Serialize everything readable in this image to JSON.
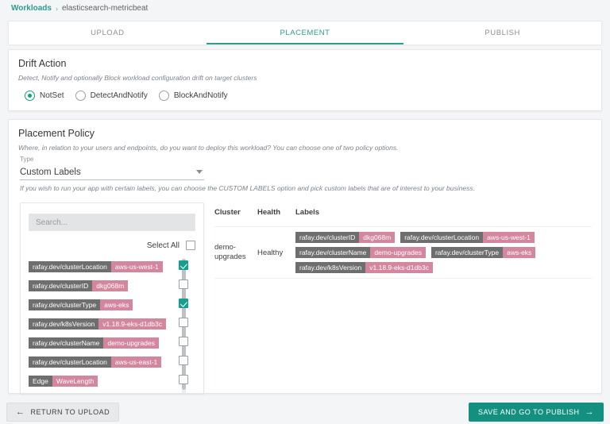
{
  "breadcrumb": {
    "root": "Workloads",
    "separator": "›",
    "current": "elasticsearch-metricbeat"
  },
  "tabs": [
    {
      "label": "UPLOAD",
      "active": false
    },
    {
      "label": "PLACEMENT",
      "active": true
    },
    {
      "label": "PUBLISH",
      "active": false
    }
  ],
  "drift": {
    "title": "Drift Action",
    "subtitle": "Detect, Notify and optionally Block workload configuration drift on target clusters",
    "options": [
      {
        "label": "NotSet",
        "selected": true
      },
      {
        "label": "DetectAndNotify",
        "selected": false
      },
      {
        "label": "BlockAndNotify",
        "selected": false
      }
    ]
  },
  "policy": {
    "title": "Placement Policy",
    "subtitle": "Where, in relation to your users and endpoints, do you want to deploy this workload? You can choose one of two policy options.",
    "type_caption": "Type",
    "type_value": "Custom Labels",
    "hint": "If you wish to run your app with certain labels, you can choose the CUSTOM LABELS option and pick custom labels that are of interest to your business."
  },
  "picker": {
    "search_placeholder": "Search...",
    "search_value": "",
    "select_all_label": "Select All",
    "select_all_checked": false,
    "labels": [
      {
        "key": "rafay.dev/clusterLocation",
        "value": "aws-us-west-1",
        "checked": true
      },
      {
        "key": "rafay.dev/clusterID",
        "value": "dkg068m",
        "checked": false
      },
      {
        "key": "rafay.dev/clusterType",
        "value": "aws-eks",
        "checked": true
      },
      {
        "key": "rafay.dev/k8sVersion",
        "value": "v1.18.9-eks-d1db3c",
        "checked": false
      },
      {
        "key": "rafay.dev/clusterName",
        "value": "demo-upgrades",
        "checked": false
      },
      {
        "key": "rafay.dev/clusterLocation",
        "value": "aws-us-east-1",
        "checked": false
      },
      {
        "key": "Edge",
        "value": "WaveLength",
        "checked": false
      }
    ]
  },
  "table": {
    "columns": [
      "Cluster",
      "Health",
      "Labels"
    ],
    "rows": [
      {
        "cluster": "demo-upgrades",
        "health": "Healthy",
        "labels": [
          {
            "key": "rafay.dev/clusterID",
            "value": "dkg068m"
          },
          {
            "key": "rafay.dev/clusterLocation",
            "value": "aws-us-west-1"
          },
          {
            "key": "rafay.dev/clusterName",
            "value": "demo-upgrades"
          },
          {
            "key": "rafay.dev/clusterType",
            "value": "aws-eks"
          },
          {
            "key": "rafay.dev/k8sVersion",
            "value": "v1.18.9-eks-d1db3c"
          }
        ]
      }
    ]
  },
  "footer": {
    "back_label": "RETURN TO UPLOAD",
    "back_icon": "arrow-left-icon",
    "next_label": "SAVE AND GO TO PUBLISH",
    "next_icon": "arrow-right-icon"
  },
  "colors": {
    "accent": "#2b9c8e",
    "primary_button": "#139080",
    "chip_key": "#6e6e6e",
    "chip_value": "#d4869f",
    "checkbox_on": "#14a08c",
    "page_background": "#f4f5f6"
  }
}
